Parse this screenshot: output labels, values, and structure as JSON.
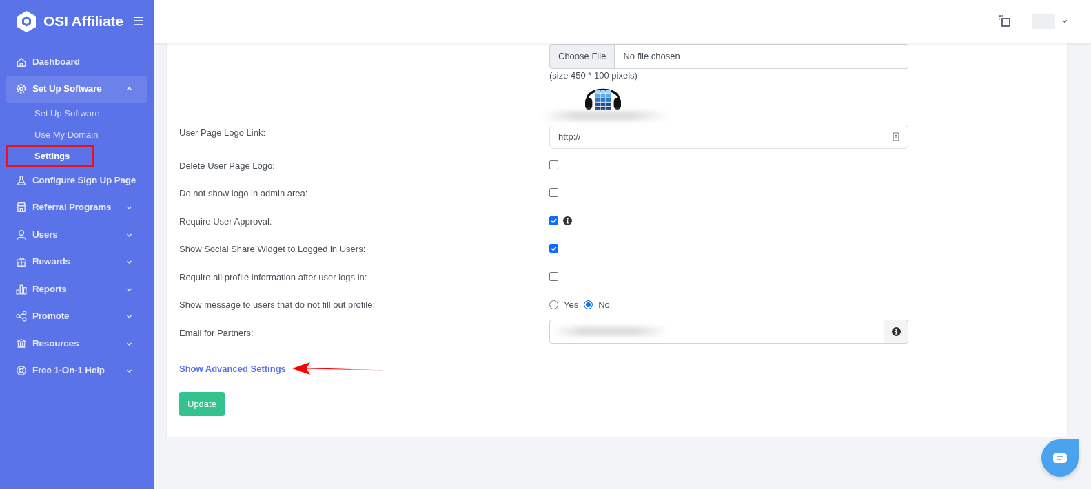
{
  "brand": {
    "name": "OSI Affiliate",
    "menu_toggle": "☰"
  },
  "sidebar": {
    "items": [
      {
        "label": "Dashboard",
        "kind": "link",
        "selected": false
      },
      {
        "label": "Set Up Software",
        "kind": "group",
        "selected": true,
        "expanded": true,
        "children": [
          {
            "label": "Set Up Software",
            "selected": false,
            "highlighted": false
          },
          {
            "label": "Use My Domain",
            "selected": false,
            "highlighted": false
          },
          {
            "label": "Settings",
            "selected": true,
            "highlighted": true
          }
        ]
      },
      {
        "label": "Configure Sign Up Page",
        "kind": "link",
        "selected": false
      },
      {
        "label": "Referral Programs",
        "kind": "group",
        "selected": false,
        "expanded": false
      },
      {
        "label": "Users",
        "kind": "group",
        "selected": false,
        "expanded": false
      },
      {
        "label": "Rewards",
        "kind": "group",
        "selected": false,
        "expanded": false
      },
      {
        "label": "Reports",
        "kind": "group",
        "selected": false,
        "expanded": false
      },
      {
        "label": "Promote",
        "kind": "group",
        "selected": false,
        "expanded": false
      },
      {
        "label": "Resources",
        "kind": "group",
        "selected": false,
        "expanded": false
      },
      {
        "label": "Free 1-On-1 Help",
        "kind": "group",
        "selected": false,
        "expanded": false
      }
    ]
  },
  "form": {
    "rows": [
      {
        "kind": "file",
        "button": "Choose File",
        "file_status": "No file chosen",
        "hint": "(size 450 * 100 pixels)"
      },
      {
        "kind": "text",
        "label": "User Page Logo Link:",
        "value": "http://"
      },
      {
        "kind": "checkbox",
        "label": "Delete User Page Logo:",
        "checked": false,
        "info": false
      },
      {
        "kind": "checkbox",
        "label": "Do not show logo in admin area:",
        "checked": false,
        "info": false
      },
      {
        "kind": "checkbox",
        "label": "Require User Approval:",
        "checked": true,
        "info": true
      },
      {
        "kind": "checkbox",
        "label": "Show Social Share Widget to Logged in Users:",
        "checked": true,
        "info": false
      },
      {
        "kind": "checkbox",
        "label": "Require all profile information after user logs in:",
        "checked": false,
        "info": false
      },
      {
        "kind": "radio",
        "label": "Show message to users that do not fill out profile:",
        "options": [
          {
            "label": "Yes",
            "selected": false
          },
          {
            "label": "No",
            "selected": true
          }
        ]
      },
      {
        "kind": "redacted",
        "label": "Email for Partners:"
      }
    ],
    "advanced_link": {
      "label": "Show Advanced Settings",
      "arrow": true
    },
    "submit": "Update"
  }
}
